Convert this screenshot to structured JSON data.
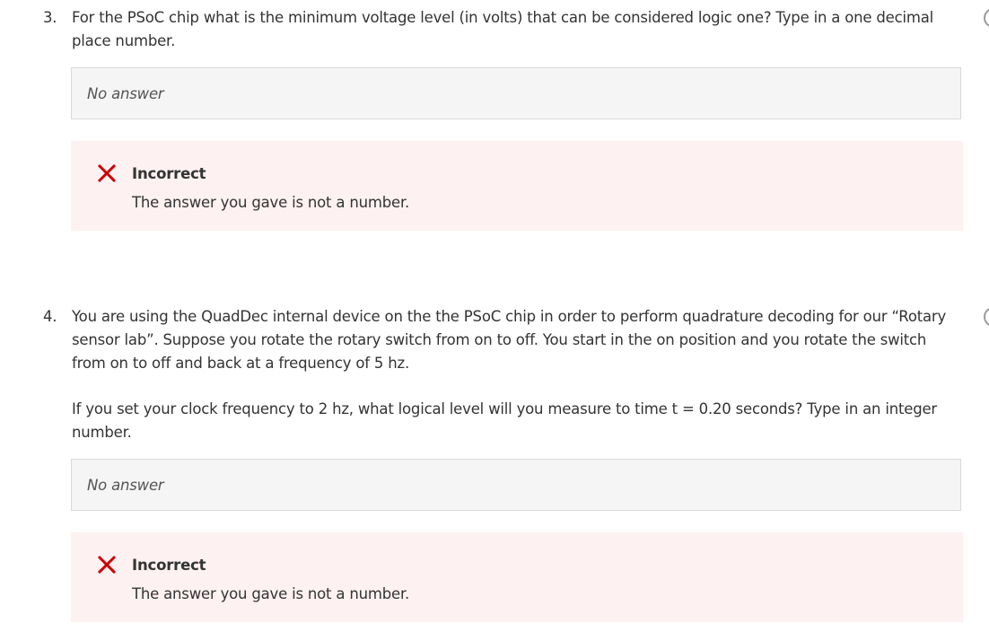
{
  "questions": [
    {
      "number": "3.",
      "paragraphs": [
        "For the PSoC chip what is the minimum voltage level (in volts) that can be considered logic one? Type in a one decimal place number."
      ],
      "answer": "No answer",
      "feedback": {
        "status": "Incorrect",
        "message": "The answer you gave is not a number."
      }
    },
    {
      "number": "4.",
      "paragraphs": [
        "You are using the QuadDec internal device on the the PSoC chip in order to perform quadrature decoding for our “Rotary sensor lab”. Suppose you rotate the rotary switch from on to off. You start in the on position and you rotate the switch from on to off and back at a frequency of 5 hz.",
        "If you set your clock frequency to 2 hz, what logical level will you measure to time t = 0.20 seconds? Type in an integer number."
      ],
      "answer": "No answer",
      "feedback": {
        "status": "Incorrect",
        "message": "The answer you gave is not a number."
      }
    }
  ],
  "colors": {
    "incorrect_icon": "#cc0000",
    "feedback_background": "#fdf1f1",
    "answer_background": "#f5f5f5"
  },
  "icons": {
    "incorrect": "close-icon"
  }
}
